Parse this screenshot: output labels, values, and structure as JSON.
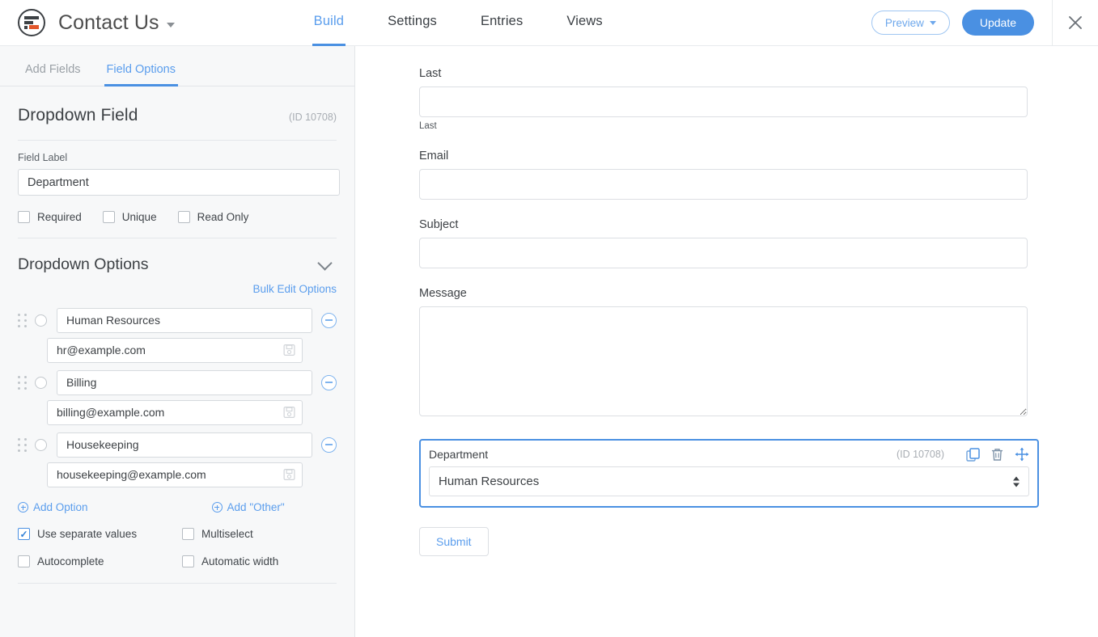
{
  "header": {
    "logo_icon": "formidable-logo-icon",
    "form_title": "Contact Us",
    "tabs": [
      {
        "label": "Build",
        "active": true
      },
      {
        "label": "Settings",
        "active": false
      },
      {
        "label": "Entries",
        "active": false
      },
      {
        "label": "Views",
        "active": false
      }
    ],
    "preview_label": "Preview",
    "update_label": "Update",
    "close_icon": "close-icon"
  },
  "sidebar": {
    "tabs": [
      {
        "label": "Add Fields",
        "active": false
      },
      {
        "label": "Field Options",
        "active": true
      }
    ],
    "field_type_title": "Dropdown Field",
    "field_id": "(ID 10708)",
    "field_label_caption": "Field Label",
    "field_label_value": "Department",
    "attribute_checkboxes": [
      {
        "label": "Required",
        "checked": false
      },
      {
        "label": "Unique",
        "checked": false
      },
      {
        "label": "Read Only",
        "checked": false
      }
    ],
    "options_section_title": "Dropdown Options",
    "bulk_edit_label": "Bulk Edit Options",
    "options": [
      {
        "label": "Human Resources",
        "value": "hr@example.com",
        "selected": false
      },
      {
        "label": "Billing",
        "value": "billing@example.com",
        "selected": false
      },
      {
        "label": "Housekeeping",
        "value": "housekeeping@example.com",
        "selected": false
      }
    ],
    "add_option_label": "Add Option",
    "add_other_label": "Add \"Other\"",
    "behavior_checkboxes": [
      {
        "label": "Use separate values",
        "checked": true
      },
      {
        "label": "Multiselect",
        "checked": false
      },
      {
        "label": "Autocomplete",
        "checked": false
      },
      {
        "label": "Automatic width",
        "checked": false
      }
    ]
  },
  "preview": {
    "fields": [
      {
        "label": "Last",
        "type": "text",
        "value": "",
        "sublabel": "Last"
      },
      {
        "label": "Email",
        "type": "text",
        "value": "",
        "sublabel": ""
      },
      {
        "label": "Subject",
        "type": "text",
        "value": "",
        "sublabel": ""
      },
      {
        "label": "Message",
        "type": "textarea",
        "value": "",
        "sublabel": ""
      }
    ],
    "selected_field": {
      "label": "Department",
      "id": "(ID 10708)",
      "selected_value": "Human Resources",
      "toolbar": [
        {
          "icon": "duplicate-icon"
        },
        {
          "icon": "trash-icon"
        },
        {
          "icon": "move-icon"
        }
      ]
    },
    "submit_label": "Submit"
  },
  "colors": {
    "accent": "#4a90e2",
    "link": "#5a9ded",
    "sidebar_bg": "#f7f8f9",
    "logo_orange": "#e2562a"
  }
}
